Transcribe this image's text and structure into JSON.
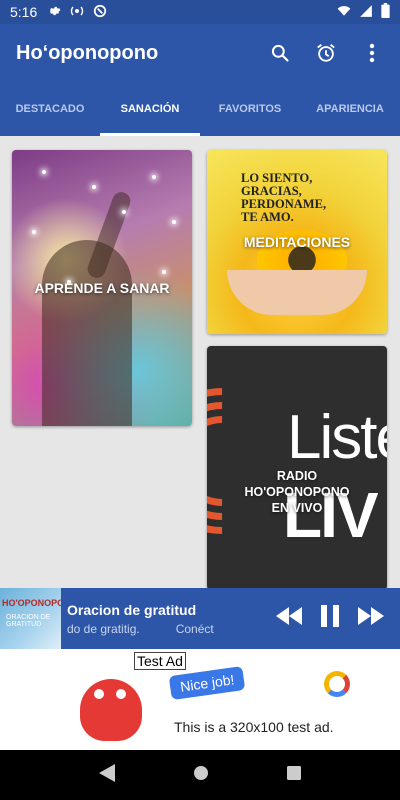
{
  "status_bar": {
    "time": "5:16",
    "left_icons": [
      "gear-icon",
      "broadcast-icon",
      "circle-hotspot-icon"
    ],
    "right_icons": [
      "wifi-icon",
      "signal-icon",
      "battery-icon"
    ]
  },
  "app_bar": {
    "title": "Ho‘oponopono",
    "actions": [
      "search-icon",
      "alarm-icon",
      "more-vert-icon"
    ]
  },
  "tabs": [
    {
      "label": "DESTACADO",
      "active": false
    },
    {
      "label": "SANACIÓN",
      "active": true
    },
    {
      "label": "FAVORITOS",
      "active": false
    },
    {
      "label": "APARIENCIA",
      "active": false
    }
  ],
  "cards": {
    "heal": {
      "label": "APRENDE A SANAR"
    },
    "meditations": {
      "label": "MEDITACIONES",
      "image_text": [
        "LO SIENTO,",
        "GRACIAS,",
        "PERDONAME,",
        "TE AMO."
      ]
    },
    "radio": {
      "label": "RADIO HO'OPONOPONO EN VIVO",
      "image_text_1": "Liste",
      "image_text_2": "LIV"
    }
  },
  "player": {
    "thumb_title": "HO'OPONOPONO",
    "thumb_subtitle": "ORACION DE GRATITUD",
    "song_title": "Oracion de gratitud",
    "subtitle": "do de gratitig.",
    "status": "Conéct"
  },
  "ad": {
    "label": "Test Ad",
    "bubble": "Nice job!",
    "text": "This is a 320x100 test ad."
  },
  "colors": {
    "primary": "#2d56a8",
    "status_bar": "#2a4f9a",
    "background": "#e6e6e6"
  }
}
